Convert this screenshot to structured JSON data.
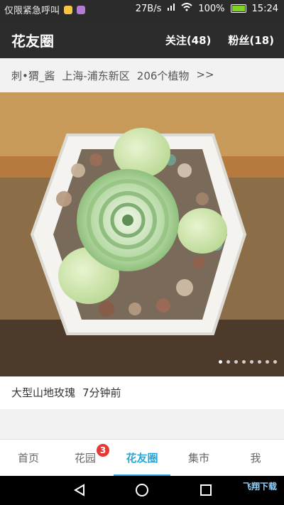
{
  "status": {
    "left_text": "仅限紧急呼叫",
    "speed": "27B/s",
    "battery": "100%",
    "time": "15:24"
  },
  "app_bar": {
    "title": "花友圈",
    "follow": "关注(48)",
    "fans": "粉丝(18)"
  },
  "user": {
    "name": "刺•猬_酱",
    "location": "上海-浦东新区",
    "plants": "206个植物",
    "more": ">>"
  },
  "post": {
    "title": "大型山地玫瑰",
    "time": "7分钟前"
  },
  "nav": {
    "items": [
      {
        "label": "首页"
      },
      {
        "label": "花园",
        "badge": "3"
      },
      {
        "label": "花友圈"
      },
      {
        "label": "集市"
      },
      {
        "label": "我"
      }
    ],
    "active": "花友圈"
  },
  "watermark": "飞翔下载",
  "colors": {
    "accent": "#2aa6d8",
    "badge": "#e53935"
  },
  "icons": [
    "back-icon",
    "home-icon",
    "recent-apps-icon",
    "wifi-icon",
    "battery-icon",
    "signal-icon"
  ]
}
